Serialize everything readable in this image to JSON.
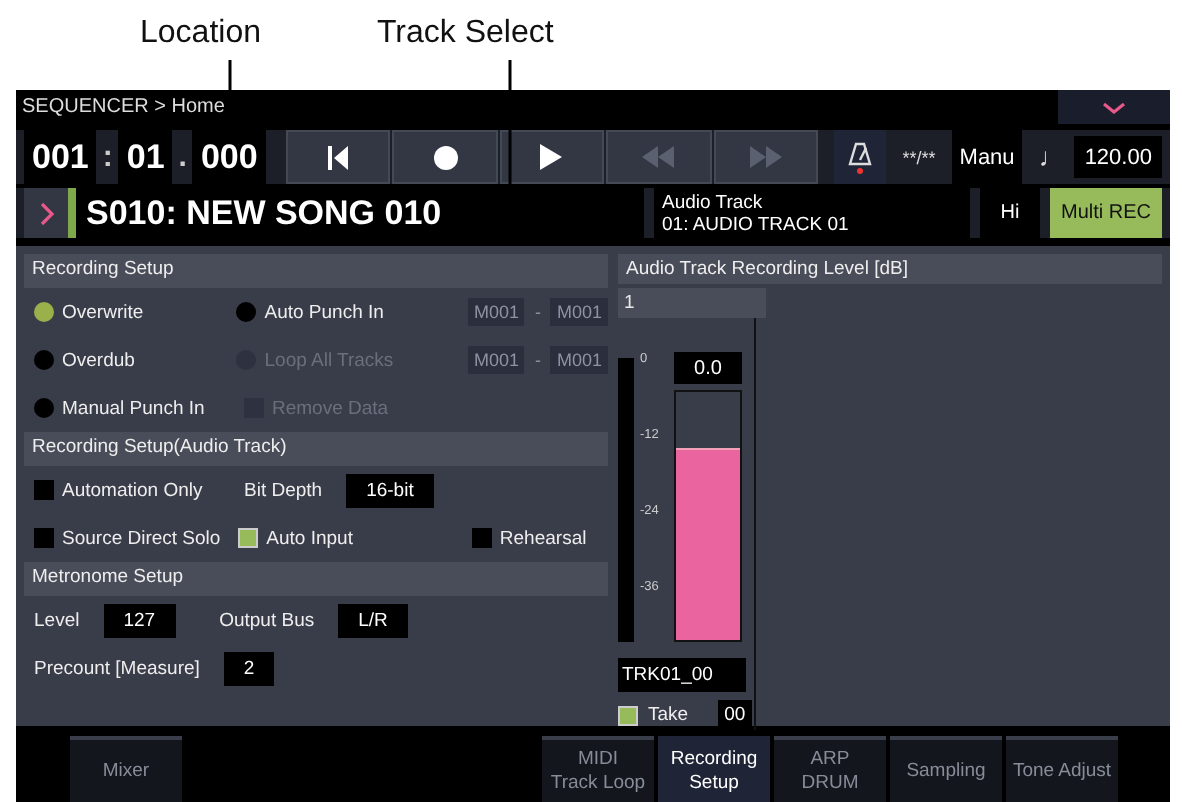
{
  "callouts": [
    {
      "label": "Location"
    },
    {
      "label": "Track Select"
    }
  ],
  "header": {
    "breadcrumb": "SEQUENCER > Home"
  },
  "location": {
    "measure": "001",
    "sep1": ":",
    "beat": "01",
    "sep2": ".",
    "tick": "000"
  },
  "transport": [
    {
      "kind": "to-start"
    },
    {
      "kind": "record"
    },
    {
      "kind": "play"
    },
    {
      "kind": "rewind"
    },
    {
      "kind": "forward"
    }
  ],
  "metronome": {
    "on": true
  },
  "time_signature": "**/**",
  "tempo_mode": "Manu",
  "tempo_symbol": "♩",
  "tempo": "120.00",
  "song": {
    "name": "S010: NEW SONG 010"
  },
  "track": {
    "type": "Audio Track",
    "name": "01: AUDIO TRACK 01"
  },
  "hi": "Hi",
  "multi_rec": {
    "label": "Multi REC",
    "on": true
  },
  "recording_setup": {
    "title": "Recording Setup",
    "rows": [
      {
        "items": [
          {
            "kind": "radio",
            "label": "Overwrite",
            "selected": true,
            "disabled": false
          },
          {
            "kind": "radio",
            "label": "Auto Punch In",
            "selected": false,
            "disabled": false
          },
          {
            "kind": "range",
            "from": "M001",
            "sep": "-",
            "to": "M001"
          }
        ]
      },
      {
        "items": [
          {
            "kind": "radio",
            "label": "Overdub",
            "selected": false,
            "disabled": false
          },
          {
            "kind": "radio",
            "label": "Loop All Tracks",
            "selected": false,
            "disabled": true
          },
          {
            "kind": "range",
            "from": "M001",
            "sep": "-",
            "to": "M001"
          }
        ]
      },
      {
        "items": [
          {
            "kind": "radio",
            "label": "Manual Punch In",
            "selected": false,
            "disabled": false
          },
          {
            "kind": "checkbox",
            "label": "Remove Data",
            "checked": false,
            "disabled": true
          }
        ]
      }
    ]
  },
  "audio_setup": {
    "title": "Recording Setup(Audio Track)",
    "rows": [
      {
        "items": [
          {
            "kind": "checkbox",
            "label": "Automation Only",
            "checked": false,
            "disabled": false
          },
          {
            "kind": "value",
            "label": "Bit Depth",
            "value": "16-bit"
          }
        ]
      },
      {
        "items": [
          {
            "kind": "checkbox",
            "label": "Source Direct Solo",
            "checked": false,
            "disabled": false
          },
          {
            "kind": "checkbox",
            "label": "Auto Input",
            "checked": true,
            "disabled": false
          },
          {
            "kind": "checkbox",
            "label": "Rehearsal",
            "checked": false,
            "disabled": false
          }
        ]
      }
    ]
  },
  "metronome_setup": {
    "title": "Metronome Setup",
    "rows": [
      {
        "items": [
          {
            "kind": "value",
            "label": "Level",
            "value": "127"
          },
          {
            "kind": "value",
            "label": "Output Bus",
            "value": "L/R"
          }
        ]
      },
      {
        "items": [
          {
            "kind": "value",
            "label": "Precount [Measure]",
            "value": "2"
          }
        ]
      }
    ]
  },
  "recording_level": {
    "title": "Audio Track Recording Level [dB]",
    "channel": "1",
    "scale": [
      "0",
      "-12",
      "-24",
      "-36"
    ],
    "reading": "0.0",
    "level": 0.77,
    "file": "TRK01_00",
    "take": {
      "label": "Take",
      "checked": true,
      "value": "00"
    }
  },
  "tabs": [
    {
      "lines": [
        "Mixer"
      ],
      "selected": false
    },
    {
      "lines": [
        "MIDI",
        "Track Loop"
      ],
      "selected": false
    },
    {
      "lines": [
        "Recording",
        "Setup"
      ],
      "selected": true
    },
    {
      "lines": [
        "ARP",
        "DRUM"
      ],
      "selected": false
    },
    {
      "lines": [
        "Sampling"
      ],
      "selected": false
    },
    {
      "lines": [
        "Tone Adjust"
      ],
      "selected": false
    }
  ]
}
